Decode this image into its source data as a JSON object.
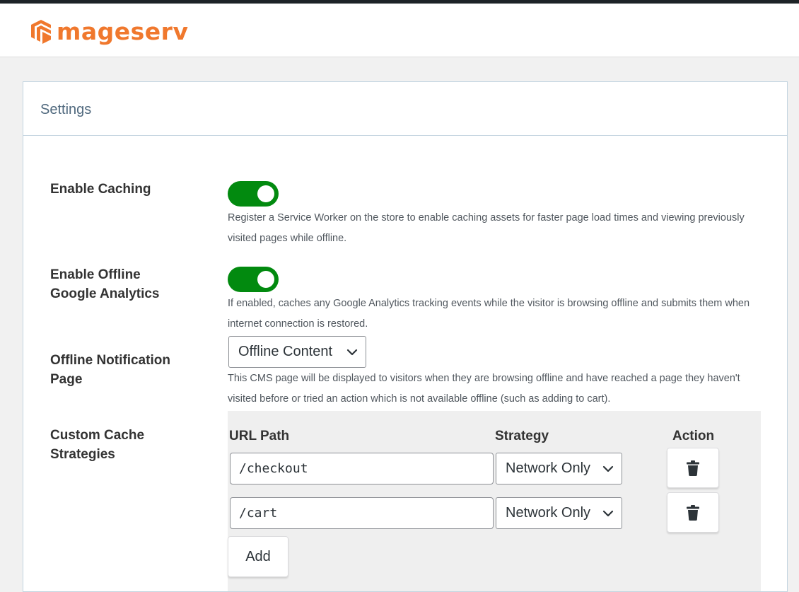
{
  "brand": {
    "name": "mageserv",
    "color": "#f0782d",
    "icon": "mageserv-logo-icon"
  },
  "card": {
    "title": "Settings"
  },
  "settings": {
    "enable_caching": {
      "label": "Enable Caching",
      "enabled": true,
      "help": "Register a Service Worker on the store to enable caching assets for faster page load times and viewing previously visited pages while offline."
    },
    "offline_analytics": {
      "label_line1": "Enable Offline",
      "label_line2": "Google Analytics",
      "enabled": true,
      "help": "If enabled, caches any Google Analytics tracking events while the visitor is browsing offline and submits them when internet connection is restored."
    },
    "offline_page": {
      "label_line1": "Offline Notification",
      "label_line2": "Page",
      "selected": "Offline Content",
      "help": "This CMS page will be displayed to visitors when they are browsing offline and have reached a page they haven't visited before or tried an action which is not available offline (such as adding to cart)."
    },
    "custom_strategies": {
      "label_line1": "Custom Cache",
      "label_line2": "Strategies",
      "columns": {
        "url": "URL Path",
        "strategy": "Strategy",
        "action": "Action"
      },
      "rows": [
        {
          "url": "/checkout",
          "strategy": "Network Only",
          "action_icon": "trash-icon"
        },
        {
          "url": "/cart",
          "strategy": "Network Only",
          "action_icon": "trash-icon"
        }
      ],
      "add_label": "Add"
    }
  },
  "colors": {
    "toggle_on": "#028a0f",
    "accent": "#f0782d",
    "title": "#50697e"
  }
}
